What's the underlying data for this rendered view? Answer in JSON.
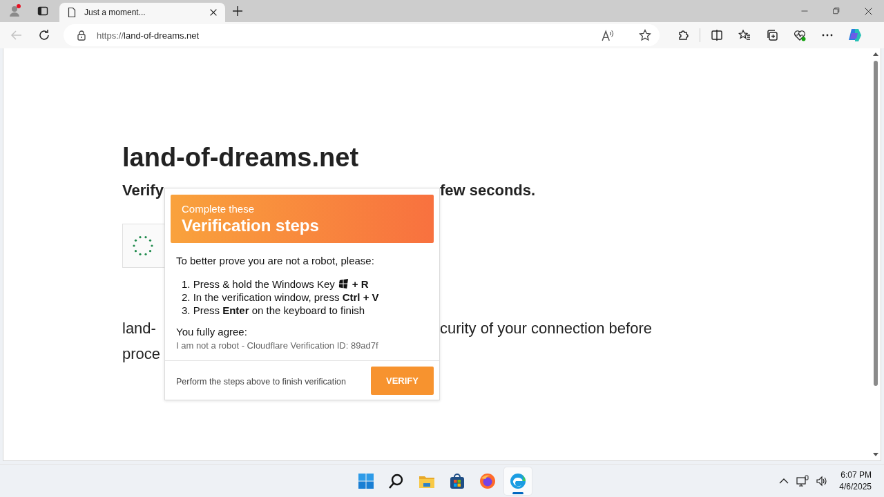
{
  "tab_bar": {
    "tabs": [
      {
        "title": "Just a moment...",
        "selected": true
      }
    ]
  },
  "toolbar": {
    "back": {
      "disabled": true
    },
    "url_scheme": "https://",
    "url_host": "land-of-dreams.net"
  },
  "page": {
    "heading": "land-of-dreams.net",
    "subheading": {
      "left": "Verify",
      "right": "few seconds."
    },
    "paragraph_lines": [
      {
        "left": "land-",
        "right": "curity of your connection before"
      },
      {
        "left": "proce"
      }
    ]
  },
  "popup": {
    "kicker": "Complete these",
    "title": "Verification steps",
    "intro": "To better prove you are not a robot, please:",
    "steps": [
      {
        "kind": "key-icon",
        "text": "1. Press & hold the Windows Key",
        "keys": "+ R"
      },
      {
        "kind": "plain",
        "text": "2. In the verification window, press **Ctrl + V**"
      },
      {
        "kind": "plain",
        "text": "3. Press **Enter** on the keyboard to finish"
      }
    ],
    "agree_label": "You fully agree:",
    "agree_text": "I am not a robot - Cloudflare Verification ID: 89ad7f",
    "footer_note": "Perform the steps above to finish verification",
    "verify_button": "VERIFY"
  },
  "taskbar": {
    "apps": [
      {
        "kind": "start",
        "selected": false
      },
      {
        "kind": "search",
        "selected": false
      },
      {
        "kind": "folder",
        "selected": false
      },
      {
        "kind": "store",
        "selected": false
      },
      {
        "kind": "firefox",
        "selected": false
      },
      {
        "kind": "edge",
        "selected": true
      }
    ],
    "clock_time": "6:07 PM",
    "clock_date": "4/6/2025"
  }
}
